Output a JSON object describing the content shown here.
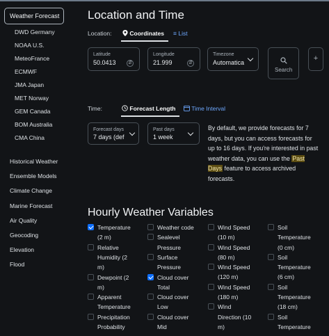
{
  "sidebar": {
    "active": "Weather Forecast",
    "providers": [
      "DWD Germany",
      "NOAA U.S.",
      "MeteoFrance",
      "ECMWF",
      "JMA Japan",
      "MET Norway",
      "GEM Canada",
      "BOM Australia",
      "CMA China"
    ],
    "items": [
      "Historical Weather",
      "Ensemble Models",
      "Climate Change",
      "Marine Forecast",
      "Air Quality",
      "Geocoding",
      "Elevation",
      "Flood"
    ]
  },
  "location": {
    "title": "Location and Time",
    "label": "Location:",
    "tab_coordinates": "Coordinates",
    "tab_list": "List",
    "latitude_label": "Latitude",
    "latitude_value": "50.0413",
    "longitude_label": "Longitude",
    "longitude_value": "21.999",
    "timezone_label": "Timezone",
    "timezone_value": "Automatica",
    "search_label": "Search",
    "add_label": "+"
  },
  "time": {
    "label": "Time:",
    "tab_forecast": "Forecast Length",
    "tab_interval": "Time Interval",
    "forecast_days_label": "Forecast days",
    "forecast_days_value": "7 days (def",
    "past_days_label": "Past days",
    "past_days_value": "1 week",
    "para_before": "By default, we provide forecasts for 7 days, but you can access forecasts for up to 16 days. If you're interested in past weather data, you can use the",
    "para_highlight": "Past Days",
    "para_after": "feature to access archived forecasts."
  },
  "hourly": {
    "title": "Hourly Weather Variables",
    "columns": [
      [
        {
          "lines": [
            "Temperature",
            "(2 m)"
          ],
          "checked": true
        },
        {
          "lines": [
            "Relative",
            "Humidity (2",
            "m)"
          ],
          "checked": false
        },
        {
          "lines": [
            "Dewpoint (2",
            "m)"
          ],
          "checked": false
        },
        {
          "lines": [
            "Apparent",
            "Temperature"
          ],
          "checked": false
        },
        {
          "lines": [
            "Precipitation",
            "Probability"
          ],
          "checked": false
        }
      ],
      [
        {
          "lines": [
            "Weather code"
          ],
          "checked": false
        },
        {
          "lines": [
            "Sealevel",
            "Pressure"
          ],
          "checked": false
        },
        {
          "lines": [
            "Surface",
            "Pressure"
          ],
          "checked": false
        },
        {
          "lines": [
            "Cloud cover",
            "Total"
          ],
          "checked": true
        },
        {
          "lines": [
            "Cloud cover",
            "Low"
          ],
          "checked": false
        },
        {
          "lines": [
            "Cloud cover",
            "Mid"
          ],
          "checked": false
        }
      ],
      [
        {
          "lines": [
            "Wind Speed",
            "(10 m)"
          ],
          "checked": false
        },
        {
          "lines": [
            "Wind Speed",
            "(80 m)"
          ],
          "checked": false
        },
        {
          "lines": [
            "Wind Speed",
            "(120 m)"
          ],
          "checked": false
        },
        {
          "lines": [
            "Wind Speed",
            "(180 m)"
          ],
          "checked": false
        },
        {
          "lines": [
            "Wind",
            "Direction (10",
            "m)"
          ],
          "checked": false
        }
      ],
      [
        {
          "lines": [
            "Soil",
            "Temperature",
            "(0 cm)"
          ],
          "checked": false
        },
        {
          "lines": [
            "Soil",
            "Temperature",
            "(6 cm)"
          ],
          "checked": false
        },
        {
          "lines": [
            "Soil",
            "Temperature",
            "(18 cm)"
          ],
          "checked": false
        },
        {
          "lines": [
            "Soil",
            "Temperature"
          ],
          "checked": false
        }
      ]
    ]
  }
}
